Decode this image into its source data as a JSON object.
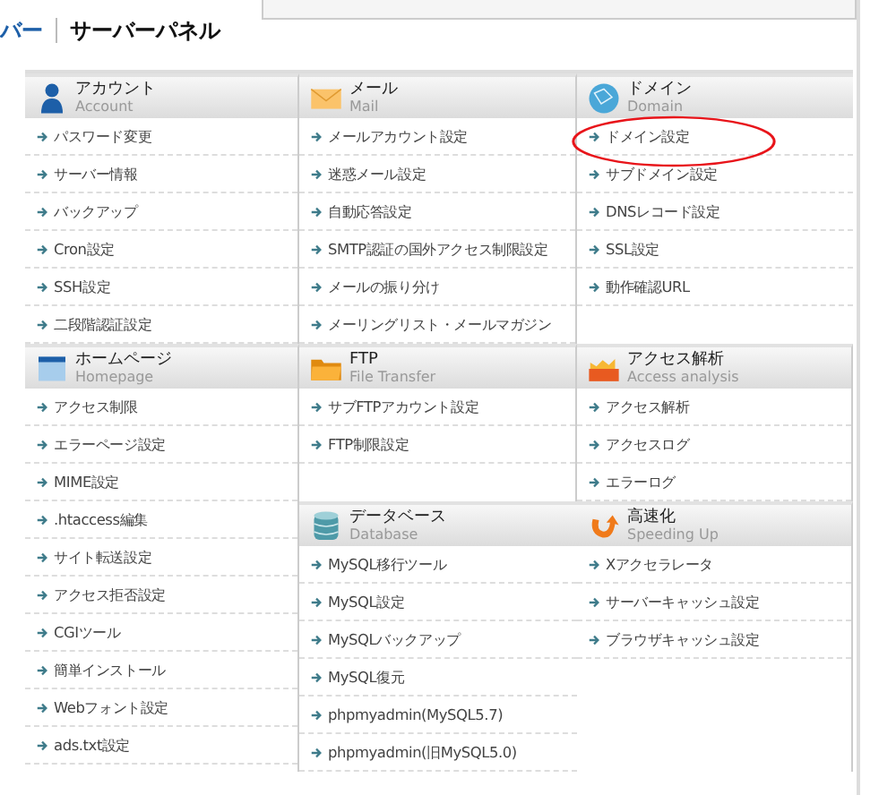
{
  "header": {
    "logo_fragment": "バー",
    "title": "サーバーパネル"
  },
  "groups": [
    {
      "columns": [
        [
          {
            "title": "アカウント",
            "subtitle": "Account",
            "items": [
              {
                "label": "パスワード変更",
                "circled": false
              },
              {
                "label": "サーバー情報",
                "circled": false
              },
              {
                "label": "バックアップ",
                "circled": false
              },
              {
                "label": "Cron設定",
                "circled": false
              },
              {
                "label": "SSH設定",
                "circled": false
              },
              {
                "label": "二段階認証設定",
                "circled": false
              }
            ]
          }
        ],
        [
          {
            "title": "メール",
            "subtitle": "Mail",
            "items": [
              {
                "label": "メールアカウント設定",
                "circled": false
              },
              {
                "label": "迷惑メール設定",
                "circled": false
              },
              {
                "label": "自動応答設定",
                "circled": false
              },
              {
                "label": "SMTP認証の国外アクセス制限設定",
                "circled": false
              },
              {
                "label": "メールの振り分け",
                "circled": false
              },
              {
                "label": "メーリングリスト・メールマガジン",
                "circled": false
              }
            ]
          }
        ],
        [
          {
            "title": "ドメイン",
            "subtitle": "Domain",
            "items": [
              {
                "label": "ドメイン設定",
                "circled": true
              },
              {
                "label": "サブドメイン設定",
                "circled": false
              },
              {
                "label": "DNSレコード設定",
                "circled": false
              },
              {
                "label": "SSL設定",
                "circled": false
              },
              {
                "label": "動作確認URL",
                "circled": false
              }
            ]
          }
        ]
      ]
    },
    {
      "columns": [
        [
          {
            "title": "ホームページ",
            "subtitle": "Homepage",
            "items": [
              {
                "label": "アクセス制限",
                "circled": false
              },
              {
                "label": "エラーページ設定",
                "circled": false
              },
              {
                "label": "MIME設定",
                "circled": false
              },
              {
                "label": ".htaccess編集",
                "circled": false
              },
              {
                "label": "サイト転送設定",
                "circled": false
              },
              {
                "label": "アクセス拒否設定",
                "circled": false
              },
              {
                "label": "CGIツール",
                "circled": false
              },
              {
                "label": "簡単インストール",
                "circled": false
              },
              {
                "label": "Webフォント設定",
                "circled": false
              },
              {
                "label": "ads.txt設定",
                "circled": false
              }
            ]
          }
        ],
        [
          {
            "title": "FTP",
            "subtitle": "File Transfer",
            "items": [
              {
                "label": "サブFTPアカウント設定",
                "circled": false
              },
              {
                "label": "FTP制限設定",
                "circled": false
              }
            ]
          },
          {
            "title": "データベース",
            "subtitle": "Database",
            "items": [
              {
                "label": "MySQL移行ツール",
                "circled": false
              },
              {
                "label": "MySQL設定",
                "circled": false
              },
              {
                "label": "MySQLバックアップ",
                "circled": false
              },
              {
                "label": "MySQL復元",
                "circled": false
              },
              {
                "label": "phpmyadmin(MySQL5.7)",
                "circled": false
              },
              {
                "label": "phpmyadmin(旧MySQL5.0)",
                "circled": false
              }
            ]
          }
        ],
        [
          {
            "title": "アクセス解析",
            "subtitle": "Access analysis",
            "items": [
              {
                "label": "アクセス解析",
                "circled": false
              },
              {
                "label": "アクセスログ",
                "circled": false
              },
              {
                "label": "エラーログ",
                "circled": false
              }
            ]
          },
          {
            "title": "高速化",
            "subtitle": "Speeding Up",
            "items": [
              {
                "label": "Xアクセラレータ",
                "circled": false
              },
              {
                "label": "サーバーキャッシュ設定",
                "circled": false
              },
              {
                "label": "ブラウザキャッシュ設定",
                "circled": false
              }
            ]
          }
        ]
      ]
    }
  ]
}
